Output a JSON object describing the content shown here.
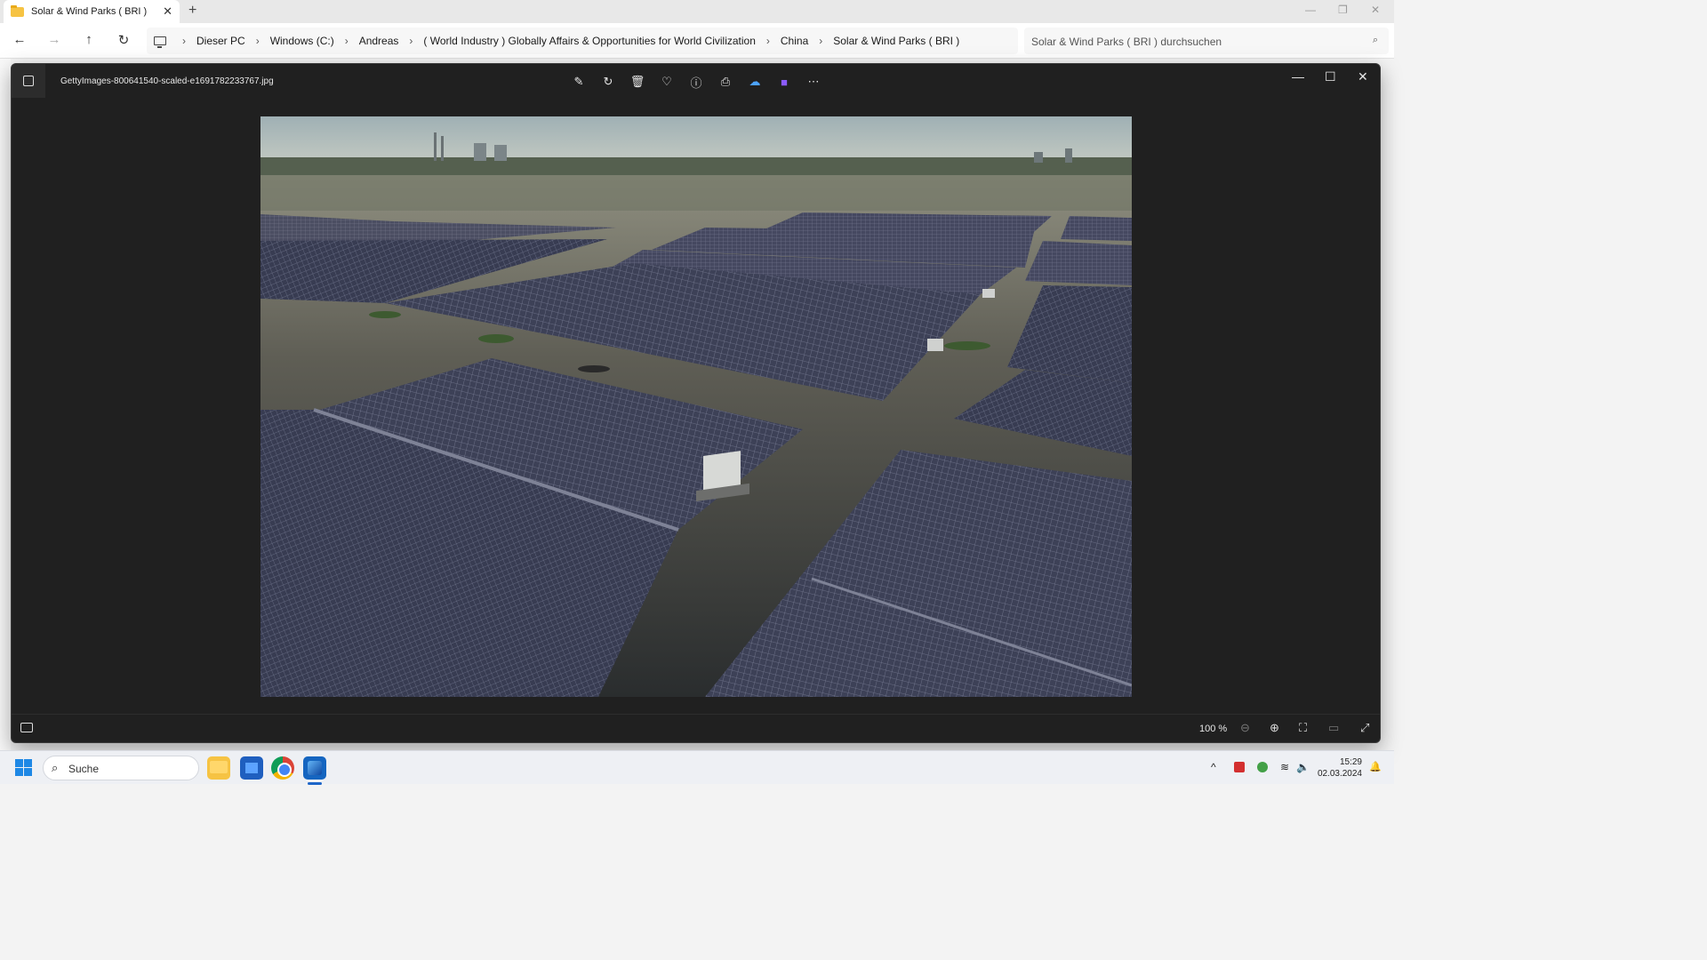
{
  "explorer": {
    "tab_title": "Solar & Wind Parks ( BRI )",
    "tab_close": "✕",
    "new_tab": "+",
    "window_controls": [
      "—",
      "❐",
      "✕"
    ],
    "nav": {
      "back": "←",
      "forward": "→",
      "up": "↑",
      "refresh": "↻"
    },
    "breadcrumbs": [
      "Dieser PC",
      "Windows (C:)",
      "Andreas",
      "( World Industry ) Globally Affairs & Opportunities for World Civilization",
      "China",
      "Solar & Wind Parks ( BRI )"
    ],
    "breadcrumb_sep": "›",
    "search_placeholder": "Solar & Wind Parks ( BRI ) durchsuchen"
  },
  "viewer": {
    "filename": "GettyImages-800641540-scaled-e1691782233767.jpg",
    "toolbar": [
      {
        "name": "edit-icon",
        "glyph": "✎"
      },
      {
        "name": "rotate-icon",
        "glyph": "↻"
      },
      {
        "name": "delete-icon",
        "glyph": "🗑"
      },
      {
        "name": "favorite-icon",
        "glyph": "♡"
      },
      {
        "name": "info-icon",
        "glyph": "ⓘ"
      },
      {
        "name": "print-icon",
        "glyph": "⎙"
      },
      {
        "name": "onedrive-icon",
        "glyph": "☁"
      },
      {
        "name": "clipchamp-icon",
        "glyph": "■"
      },
      {
        "name": "more-icon",
        "glyph": "⋯"
      }
    ],
    "window_controls": [
      "—",
      "☐",
      "✕"
    ],
    "zoom": "100 %",
    "bottom_icons": {
      "zoom_out": "⊖",
      "zoom_in": "⊕",
      "fit": "⛶",
      "actual_size": "▭",
      "fullscreen": "⤢"
    }
  },
  "taskbar": {
    "search_label": "Suche",
    "search_glyph": "⌕",
    "tray_chevron": "^",
    "tray_wifi": "≋",
    "tray_volume": "🔈",
    "tray_notification": "🔔",
    "time": "15:29",
    "date": "02.03.2024"
  },
  "colors": {
    "viewer_bg": "#202020",
    "water": "#3b3d3c",
    "panel": "#3a3e52",
    "sky": "#b7c3c4"
  }
}
